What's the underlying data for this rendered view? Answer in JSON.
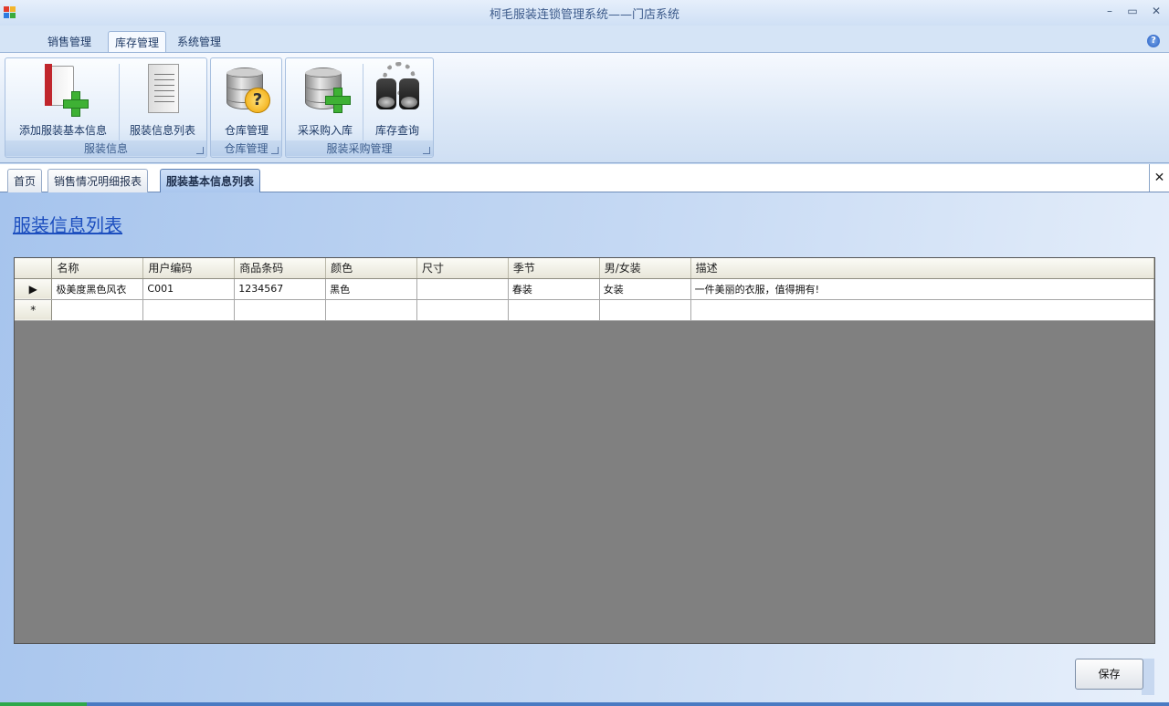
{
  "window": {
    "title": "柯毛服装连锁管理系统——门店系统",
    "minimize": "–",
    "restore": "▭",
    "close": "✕"
  },
  "menu_tabs": [
    "销售管理",
    "库存管理",
    "系统管理"
  ],
  "active_menu_tab": "库存管理",
  "help_icon": "?",
  "ribbon": {
    "groups": [
      {
        "label": "服装信息",
        "buttons": [
          "添加服装基本信息",
          "服装信息列表"
        ]
      },
      {
        "label": "仓库管理",
        "buttons": [
          "仓库管理"
        ]
      },
      {
        "label": "服装采购管理",
        "buttons": [
          "采采购入库",
          "库存查询"
        ]
      }
    ]
  },
  "doc_tabs": [
    "首页",
    "销售情况明细报表",
    "服装基本信息列表"
  ],
  "active_doc_tab": "服装基本信息列表",
  "doc_close": "✕",
  "page_title": "服装信息列表",
  "grid": {
    "columns": [
      "名称",
      "用户编码",
      "商品条码",
      "颜色",
      "尺寸",
      "季节",
      "男/女装",
      "描述"
    ],
    "rows": [
      {
        "marker": "▶",
        "cells": [
          "极美度黑色风衣",
          "C001",
          "1234567",
          "黑色",
          "",
          "春装",
          "女装",
          "一件美丽的衣服，值得拥有!"
        ]
      },
      {
        "marker": "*",
        "cells": [
          "",
          "",
          "",
          "",
          "",
          "",
          "",
          ""
        ]
      }
    ]
  },
  "save_button": "保存",
  "colors": {
    "accent": "#1d4fbf",
    "grid_empty": "#808080"
  }
}
